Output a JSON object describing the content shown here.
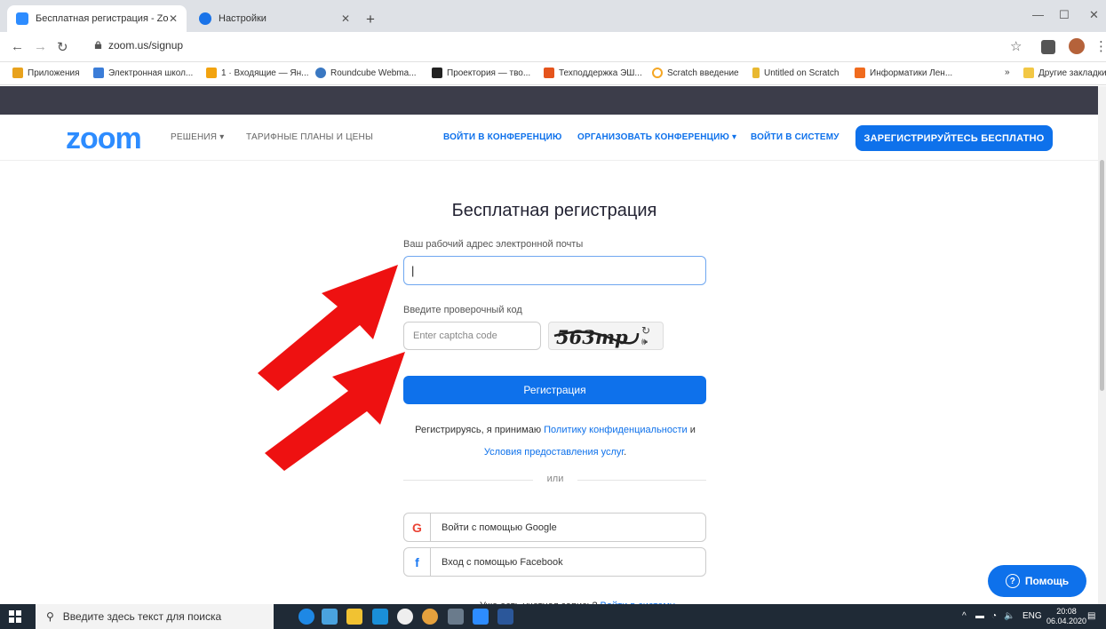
{
  "browser": {
    "tabs": [
      {
        "title": "Бесплатная регистрация - Zoom",
        "favicon_color": "#2d8cff",
        "active": true
      },
      {
        "title": "Настройки",
        "favicon_color": "#1a73e8",
        "active": false
      }
    ],
    "new_tab_icon": "plus-icon",
    "url": "zoom.us/signup",
    "bookmarks": [
      {
        "label": "Приложения",
        "icon": "apps-grid-icon",
        "color": "#e8a21d"
      },
      {
        "label": "Электронная школ...",
        "icon": "school-icon",
        "color": "#3b7dd8"
      },
      {
        "label": "1 · Входящие — Ян...",
        "icon": "mail-icon",
        "color": "#f2a30f"
      },
      {
        "label": "Roundcube Webma...",
        "icon": "roundcube-icon",
        "color": "#3a78c2"
      },
      {
        "label": "Проектория — тво...",
        "icon": "proektoria-icon",
        "color": "#222"
      },
      {
        "label": "Техподдержка ЭШ...",
        "icon": "support-icon",
        "color": "#e5541c"
      },
      {
        "label": "Scratch введение",
        "icon": "scratch-icon",
        "color": "#f5a623"
      },
      {
        "label": "Untitled on Scratch",
        "icon": "scratch-cat-icon",
        "color": "#e8b830"
      },
      {
        "label": "Информатики Лен...",
        "icon": "blogger-icon",
        "color": "#f06b1e"
      },
      {
        "label": "»",
        "icon": "",
        "color": ""
      },
      {
        "label": "Другие закладки",
        "icon": "folder-icon",
        "color": "#f2c744"
      }
    ]
  },
  "nav": {
    "logo": "zoom",
    "solutions": "РЕШЕНИЯ",
    "pricing": "ТАРИФНЫЕ ПЛАНЫ И ЦЕНЫ",
    "join": "ВОЙТИ В КОНФЕРЕНЦИЮ",
    "host": "ОРГАНИЗОВАТЬ КОНФЕРЕНЦИЮ",
    "signin": "ВОЙТИ В СИСТЕМУ",
    "signup": "ЗАРЕГИСТРИРУЙТЕСЬ БЕСПЛАТНО"
  },
  "form": {
    "title": "Бесплатная регистрация",
    "email_label": "Ваш рабочий адрес электронной почты",
    "email_value": "|",
    "captcha_label": "Введите проверочный код",
    "captcha_placeholder": "Enter captcha code",
    "captcha_text": "563mp",
    "register": "Регистрация",
    "terms_prefix": "Регистрируясь, я принимаю",
    "privacy_link": "Политику конфиденциальности",
    "terms_and": "и",
    "terms_link": "Условия предоставления услуг",
    "terms_suffix": ".",
    "or": "или",
    "google": "Войти с помощью Google",
    "facebook": "Вход с помощью Facebook",
    "cutoff_text": "Уже есть учетная запись?",
    "cutoff_link": "Войти в систему"
  },
  "help": "Помощь",
  "taskbar": {
    "search_placeholder": "Введите здесь текст для поиска",
    "lang": "ENG",
    "time": "20:08",
    "date": "06.04.2020"
  },
  "colors": {
    "accent": "#0e71eb",
    "logo": "#2d8cff",
    "arrow": "#ee1111",
    "dark_band": "#3c3d4a"
  }
}
